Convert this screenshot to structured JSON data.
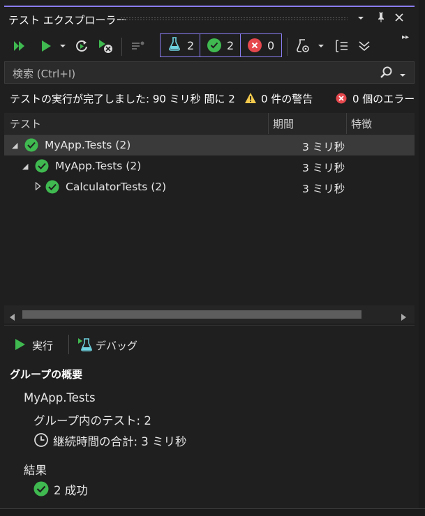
{
  "window": {
    "title": "テスト エクスプローラー",
    "controls": {
      "dropdown": "▾",
      "pin": "📌",
      "close": "✕"
    }
  },
  "toolbar": {
    "icons": [
      "run-all-icon",
      "run-icon",
      "run-dropdown-icon",
      "repeat-icon",
      "cancel-run-icon",
      "playlist-icon",
      "settings-flask-icon",
      "group-by-icon",
      "expand-icon"
    ],
    "total_count": "2",
    "passed_count": "2",
    "failed_count": "0"
  },
  "search": {
    "placeholder": "検索 (Ctrl+I)"
  },
  "status": {
    "summary": "テストの実行が完了しました: 90 ミリ秒 間に 2",
    "warnings": "0 件の警告",
    "errors": "0 個のエラー"
  },
  "columns": {
    "test": "テスト",
    "duration": "期間",
    "traits": "特徴"
  },
  "tree": [
    {
      "label": "MyApp.Tests (2)",
      "duration": "3 ミリ秒",
      "level": 0,
      "expanded": true,
      "selected": true
    },
    {
      "label": "MyApp.Tests (2)",
      "duration": "3 ミリ秒",
      "level": 1,
      "expanded": true,
      "selected": false
    },
    {
      "label": "CalculatorTests (2)",
      "duration": "3 ミリ秒",
      "level": 2,
      "expanded": false,
      "selected": false
    }
  ],
  "details": {
    "run_label": "実行",
    "debug_label": "デバッグ",
    "section_title": "グループの概要",
    "group_name": "MyApp.Tests",
    "tests_in_group": "グループ内のテスト: 2",
    "total_duration": "継続時間の合計: 3 ミリ秒",
    "results_heading": "結果",
    "passed_result": "2 成功"
  },
  "colors": {
    "accent": "#8a7cf0",
    "passed": "#3fb950",
    "failed": "#e5484d",
    "warning": "#f2c94c"
  }
}
